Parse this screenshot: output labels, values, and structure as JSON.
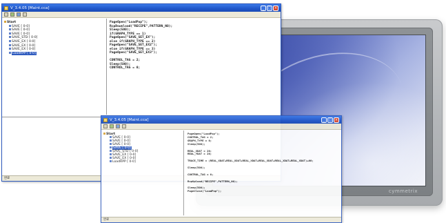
{
  "device": {
    "brand": "cymmetrix"
  },
  "window_back": {
    "title": "V_3.4.05 [Maint.cca]",
    "buttons": {
      "minimize": "_",
      "maximize": "□",
      "close": "×"
    },
    "tree": {
      "root": "Start",
      "items": [
        {
          "label": "SAVE [ 0-0]",
          "selected": false
        },
        {
          "label": "SAVE [ 0-0]",
          "selected": false
        },
        {
          "label": "SAVE [ 0-0]",
          "selected": false
        },
        {
          "label": "SAVE_STD [ 0-0]",
          "selected": false
        },
        {
          "label": "SAVE_EX [ 0-0]",
          "selected": false
        },
        {
          "label": "SAVE_EX [ 0-0]",
          "selected": false
        },
        {
          "label": "SAVE_EX [ 0-0]",
          "selected": false
        },
        {
          "label": "LoadRPP [ 0-0]",
          "selected": true
        }
      ]
    },
    "code": [
      "PageOpen(\"LoadPop\");",
      "RcpDownload(\"RECIPE\",PATTERN_NO);",
      "Sleep(500);",
      "if(GRAPH_TYPE == 1)",
      "PageOpen(\"SAVE_SET_EX\");",
      "else if(GRAPH_TYPE == 2)",
      "PageOpen(\"SAVE_SET_EX2\");",
      "else if(GRAPH_TYPE == 3)",
      "PageOpen(\"SAVE_SET_EX3\");",
      "",
      "CONTROL_TAG = 2;",
      "Sleep(500);",
      "CONTROL_TAG = 0;"
    ],
    "status": "완료"
  },
  "window_front": {
    "title": "V_3.4.05 [Maint.cca]",
    "buttons": {
      "minimize": "_",
      "maximize": "□",
      "close": "×"
    },
    "tree": {
      "root": "Start",
      "items": [
        {
          "label": "SAVE [ 0-0]",
          "selected": false
        },
        {
          "label": "SAVE [ 0-0]",
          "selected": false
        },
        {
          "label": "SAVE [ 0-0]",
          "selected": false
        },
        {
          "label": "SAVE [ 0-0]",
          "selected": true
        },
        {
          "label": "SAVE_STD [ 0-0]",
          "selected": false
        },
        {
          "label": "SAVE_EX [ 0-0]",
          "selected": false
        },
        {
          "label": "SAVE_EX [ 0-0]",
          "selected": false
        },
        {
          "label": "LoadRPP [ 0-0]",
          "selected": false
        }
      ]
    },
    "code": [
      "PageOpen(\"LoadPop\");",
      "CONTROL_TAG = 2;",
      "GRAPH_TYPE = 0;",
      "Sleep(500);",
      "",
      "REAL_XDAT = 20;",
      "REAL_YDAT = 20;",
      "",
      "TRACE_TIME = (REAL_XDAT+REAL_XDAT+REAL_XDAT+REAL_XDAT+REAL_XDAT+REAL_XDAT)+60;",
      "",
      "Sleep(500);",
      "",
      "CONTROL_TAG = 0;",
      "",
      "RcpUpload(\"RECIPE\",PATTERN_NO);",
      "",
      "Sleep(500);",
      "PageClose(\"LoadPop\");"
    ],
    "status": "완료"
  }
}
